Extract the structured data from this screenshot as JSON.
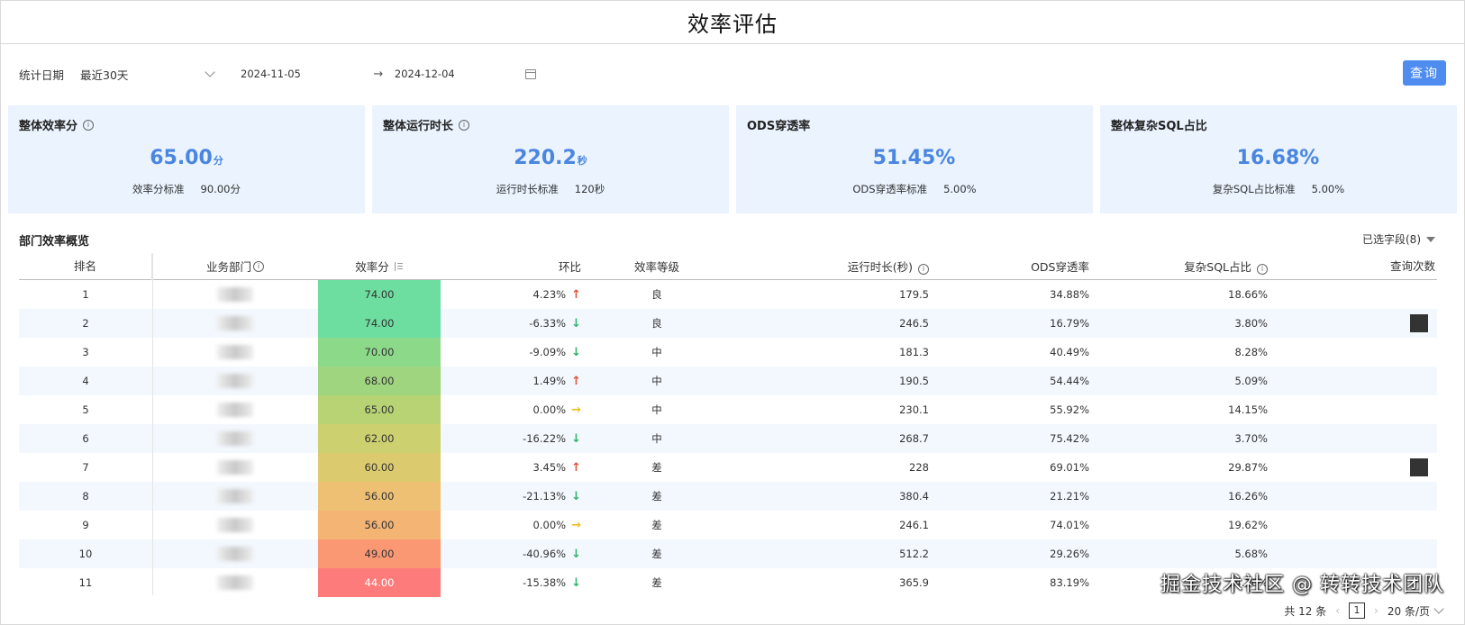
{
  "title": "效率评估",
  "filter": {
    "label": "统计日期",
    "range_preset": "最近30天",
    "start_date": "2024-11-05",
    "arrow": "→",
    "end_date": "2024-12-04",
    "query_label": "查询"
  },
  "cards": [
    {
      "title": "整体效率分",
      "has_info": true,
      "value": "65.00",
      "unit": "分",
      "std_label": "效率分标准",
      "std_value": "90.00分"
    },
    {
      "title": "整体运行时长",
      "has_info": true,
      "value": "220.2",
      "unit": "秒",
      "std_label": "运行时长标准",
      "std_value": "120秒"
    },
    {
      "title": "ODS穿透率",
      "has_info": false,
      "value": "51.45%",
      "unit": "",
      "std_label": "ODS穿透率标准",
      "std_value": "5.00%"
    },
    {
      "title": "整体复杂SQL占比",
      "has_info": false,
      "value": "16.68%",
      "unit": "",
      "std_label": "复杂SQL占比标准",
      "std_value": "5.00%"
    }
  ],
  "section_title": "部门效率概览",
  "selected_fields": "已选字段(8)",
  "table": {
    "headers": {
      "rank": "排名",
      "dept": "业务部门",
      "score": "效率分",
      "change": "环比",
      "level": "效率等级",
      "runtime": "运行时长(秒)",
      "ods": "ODS穿透率",
      "sql": "复杂SQL占比",
      "queries": "查询次数"
    },
    "rows": [
      {
        "rank": "1",
        "score": "74.00",
        "change": "4.23%",
        "dir": "up",
        "level": "良",
        "runtime": "179.5",
        "ods": "34.88%",
        "sql": "18.66%",
        "color": "#6ddda0",
        "blk": false
      },
      {
        "rank": "2",
        "score": "74.00",
        "change": "-6.33%",
        "dir": "down",
        "level": "良",
        "runtime": "246.5",
        "ods": "16.79%",
        "sql": "3.80%",
        "color": "#6ddda0",
        "blk": true
      },
      {
        "rank": "3",
        "score": "70.00",
        "change": "-9.09%",
        "dir": "down",
        "level": "中",
        "runtime": "181.3",
        "ods": "40.49%",
        "sql": "8.28%",
        "color": "#8cd98a",
        "blk": false
      },
      {
        "rank": "4",
        "score": "68.00",
        "change": "1.49%",
        "dir": "up",
        "level": "中",
        "runtime": "190.5",
        "ods": "54.44%",
        "sql": "5.09%",
        "color": "#9fd57e",
        "blk": false
      },
      {
        "rank": "5",
        "score": "65.00",
        "change": "0.00%",
        "dir": "flat",
        "level": "中",
        "runtime": "230.1",
        "ods": "55.92%",
        "sql": "14.15%",
        "color": "#b7d374",
        "blk": false
      },
      {
        "rank": "6",
        "score": "62.00",
        "change": "-16.22%",
        "dir": "down",
        "level": "中",
        "runtime": "268.7",
        "ods": "75.42%",
        "sql": "3.70%",
        "color": "#ccd06e",
        "blk": false
      },
      {
        "rank": "7",
        "score": "60.00",
        "change": "3.45%",
        "dir": "up",
        "level": "差",
        "runtime": "228",
        "ods": "69.01%",
        "sql": "29.87%",
        "color": "#dccb6e",
        "blk": true
      },
      {
        "rank": "8",
        "score": "56.00",
        "change": "-21.13%",
        "dir": "down",
        "level": "差",
        "runtime": "380.4",
        "ods": "21.21%",
        "sql": "16.26%",
        "color": "#eec074",
        "blk": false
      },
      {
        "rank": "9",
        "score": "56.00",
        "change": "0.00%",
        "dir": "flat",
        "level": "差",
        "runtime": "246.1",
        "ods": "74.01%",
        "sql": "19.62%",
        "color": "#f3b474",
        "blk": false
      },
      {
        "rank": "10",
        "score": "49.00",
        "change": "-40.96%",
        "dir": "down",
        "level": "差",
        "runtime": "512.2",
        "ods": "29.26%",
        "sql": "5.68%",
        "color": "#fb9874",
        "blk": false
      },
      {
        "rank": "11",
        "score": "44.00",
        "change": "-15.38%",
        "dir": "down",
        "level": "差",
        "runtime": "365.9",
        "ods": "83.19%",
        "sql": "14.16%",
        "color": "#fe7b7b",
        "blk": false
      }
    ]
  },
  "pager": {
    "total": "共 12 条",
    "page": "1",
    "page_size": "20 条/页"
  },
  "watermark": "掘金技术社区 @ 转转技术团队",
  "colors": {
    "accent": "#4e8cf0",
    "card_bg": "#eaf3fe",
    "value_blue": "#4a86e0",
    "up": "#e0503b",
    "down": "#2fb36a",
    "flat": "#f0c020"
  }
}
